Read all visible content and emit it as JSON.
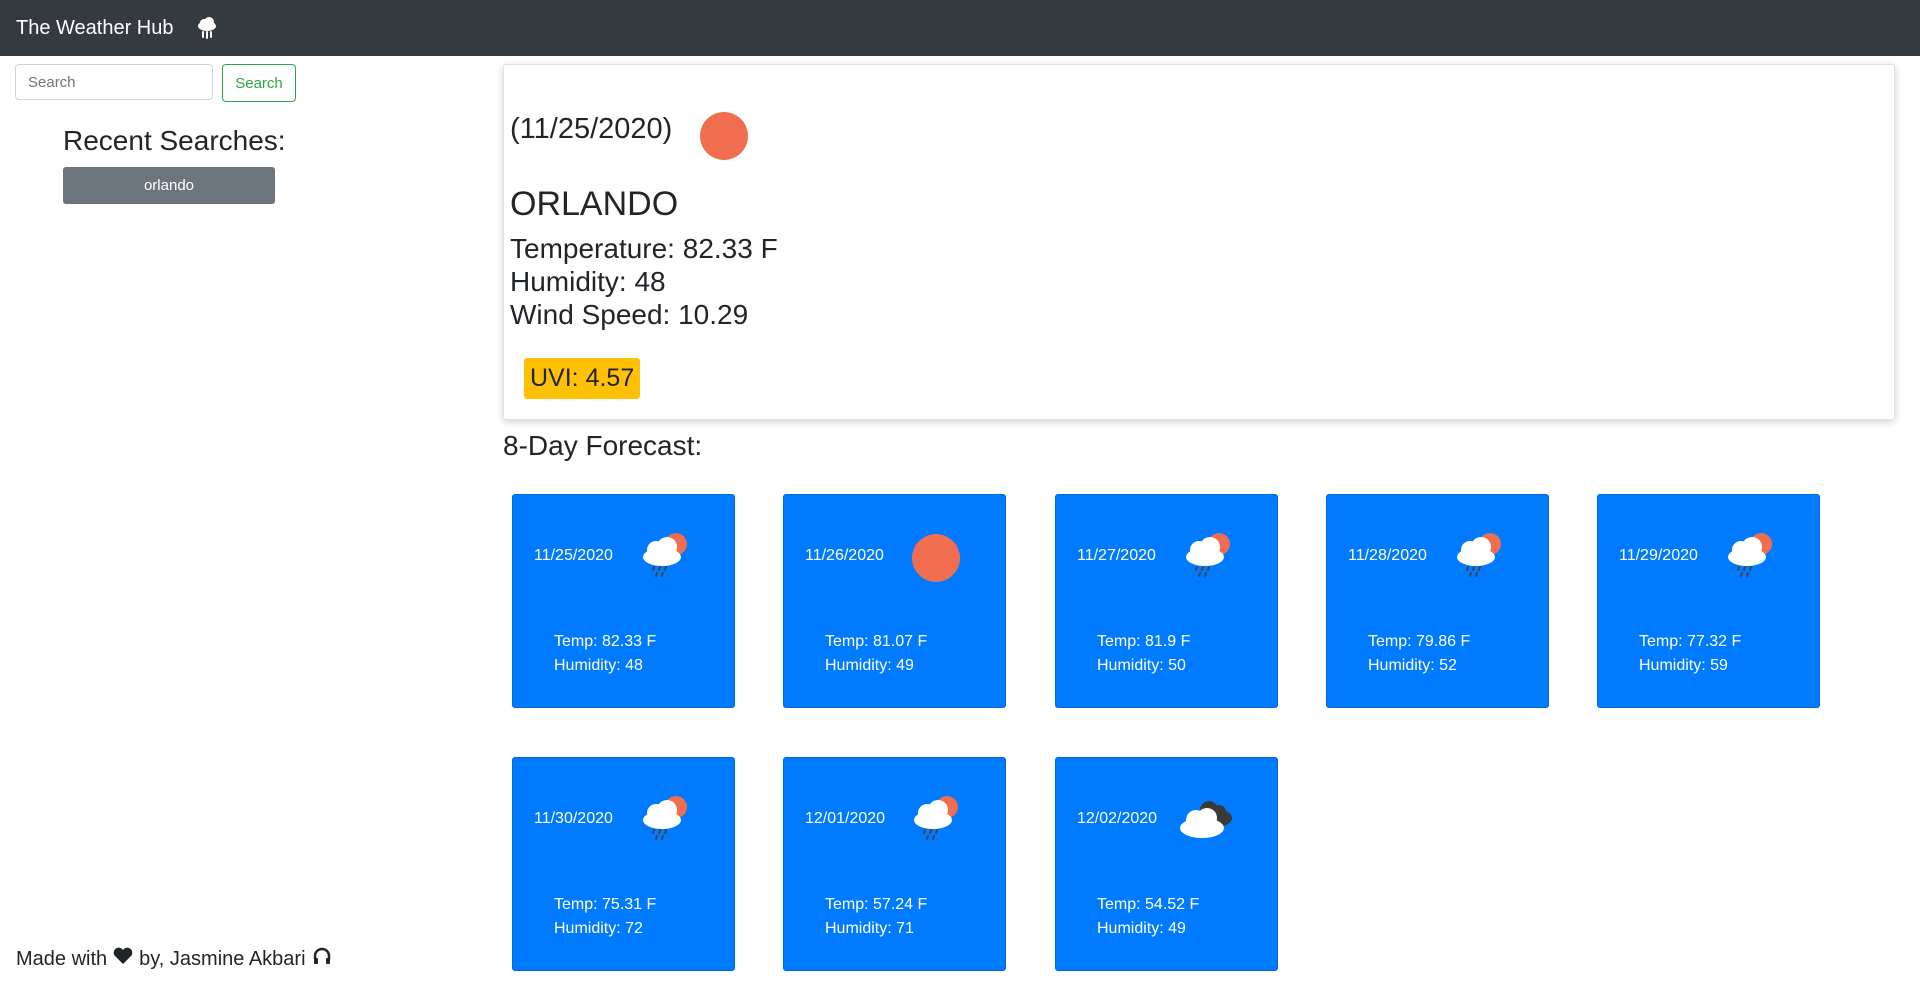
{
  "navbar": {
    "brand": "The Weather Hub",
    "brand_icon": "cloud-rain-icon"
  },
  "search": {
    "placeholder": "Search",
    "value": "",
    "button_label": "Search"
  },
  "sidebar": {
    "recent_title": "Recent Searches:",
    "recent": [
      "orlando"
    ]
  },
  "footer": {
    "made_with": "Made with",
    "by": "by, Jasmine Akbari",
    "heart_icon": "heart-icon",
    "headphones_icon": "headphones-icon"
  },
  "current": {
    "date": "(11/25/2020)",
    "icon": "sun-icon",
    "city": "ORLANDO",
    "temperature": "Temperature: 82.33 F",
    "humidity": "Humidity: 48",
    "wind": "Wind Speed: 10.29",
    "uvi": "UVI: 4.57",
    "uvi_color": "#ffc107"
  },
  "forecast_title": "8-Day Forecast:",
  "forecast": [
    {
      "date": "11/25/2020",
      "icon": "rain-sun-cloud-icon",
      "temp": "Temp: 82.33 F",
      "humidity": "Humidity: 48"
    },
    {
      "date": "11/26/2020",
      "icon": "sun-icon",
      "temp": "Temp: 81.07 F",
      "humidity": "Humidity: 49"
    },
    {
      "date": "11/27/2020",
      "icon": "rain-sun-cloud-icon",
      "temp": "Temp: 81.9 F",
      "humidity": "Humidity: 50"
    },
    {
      "date": "11/28/2020",
      "icon": "rain-sun-cloud-icon",
      "temp": "Temp: 79.86 F",
      "humidity": "Humidity: 52"
    },
    {
      "date": "11/29/2020",
      "icon": "rain-sun-cloud-icon",
      "temp": "Temp: 77.32 F",
      "humidity": "Humidity: 59"
    },
    {
      "date": "11/30/2020",
      "icon": "rain-sun-cloud-icon",
      "temp": "Temp: 75.31 F",
      "humidity": "Humidity: 72"
    },
    {
      "date": "12/01/2020",
      "icon": "rain-sun-cloud-icon",
      "temp": "Temp: 57.24 F",
      "humidity": "Humidity: 71"
    },
    {
      "date": "12/02/2020",
      "icon": "overcast-clouds-icon",
      "temp": "Temp: 54.52 F",
      "humidity": "Humidity: 49"
    }
  ],
  "colors": {
    "navbar": "#343a40",
    "card": "#007bff",
    "sun": "#ee6e4f",
    "search_button": "#28a745",
    "recent_button": "#6c757d"
  }
}
